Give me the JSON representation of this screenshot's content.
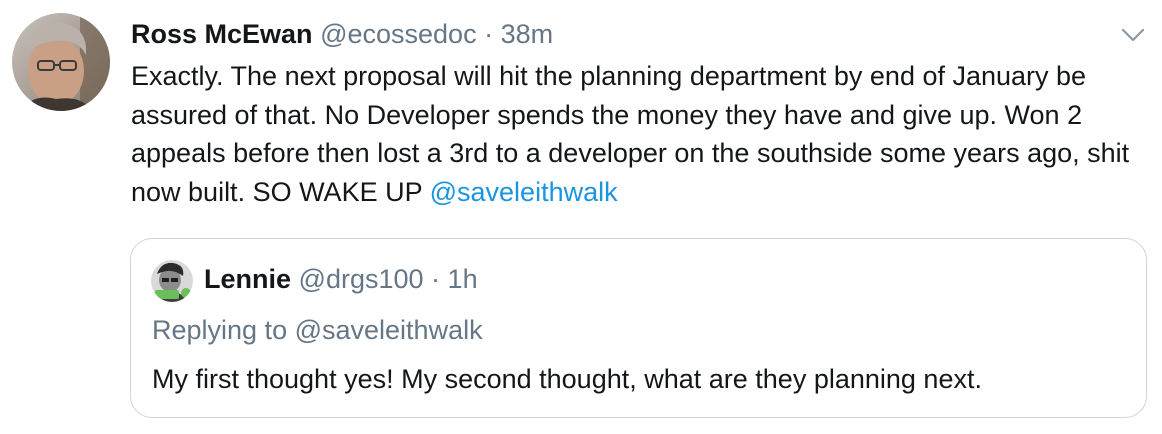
{
  "tweet": {
    "author_name": "Ross McEwan",
    "author_handle": "@ecossedoc",
    "separator": "·",
    "time": "38m",
    "text_before_mention": "Exactly. The next proposal will hit the planning department by end of January be assured of that. No Developer spends the money they have and give up. Won 2 appeals before then lost a 3rd to a developer on the southside some years ago, shit now built. SO WAKE UP ",
    "mention": "@saveleithwalk",
    "caret_icon": "chevron-down-icon"
  },
  "quoted_tweet": {
    "author_name": "Lennie",
    "author_handle": "@drgs100",
    "separator": "·",
    "time": "1h",
    "replying_prefix": "Replying to ",
    "replying_to": "@saveleithwalk",
    "text": "My first thought yes! My second thought, what are they planning next."
  },
  "colors": {
    "text": "#14171a",
    "muted": "#657786",
    "link": "#1b95e0",
    "border": "#ccd6dd"
  }
}
